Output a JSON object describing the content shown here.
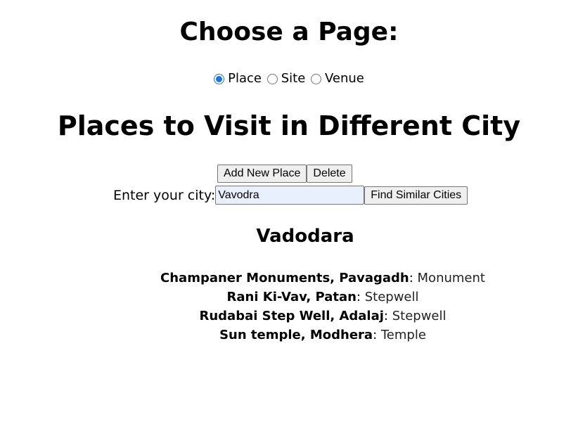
{
  "chooser": {
    "title": "Choose a Page:",
    "options": [
      {
        "label": "Place",
        "checked": true
      },
      {
        "label": "Site",
        "checked": false
      },
      {
        "label": "Venue",
        "checked": false
      }
    ]
  },
  "main": {
    "title": "Places to Visit in Different City",
    "add_label": "Add New Place",
    "delete_label": "Delete",
    "city_label": "Enter your city:",
    "city_value": "Vavodra",
    "find_label": "Find Similar Cities"
  },
  "result": {
    "city": "Vadodara",
    "places": [
      {
        "name": "Champaner Monuments, Pavagadh",
        "sep": ": ",
        "type": "Monument"
      },
      {
        "name": "Rani Ki-Vav, Patan",
        "sep": ": ",
        "type": "Stepwell"
      },
      {
        "name": "Rudabai Step Well, Adalaj",
        "sep": ": ",
        "type": "Stepwell"
      },
      {
        "name": "Sun temple, Modhera",
        "sep": ": ",
        "type": "Temple"
      }
    ]
  },
  "colors": {
    "radio_accent": "#1a73e8",
    "input_autofill_bg": "#e8f0fe",
    "button_bg": "#efefef"
  }
}
